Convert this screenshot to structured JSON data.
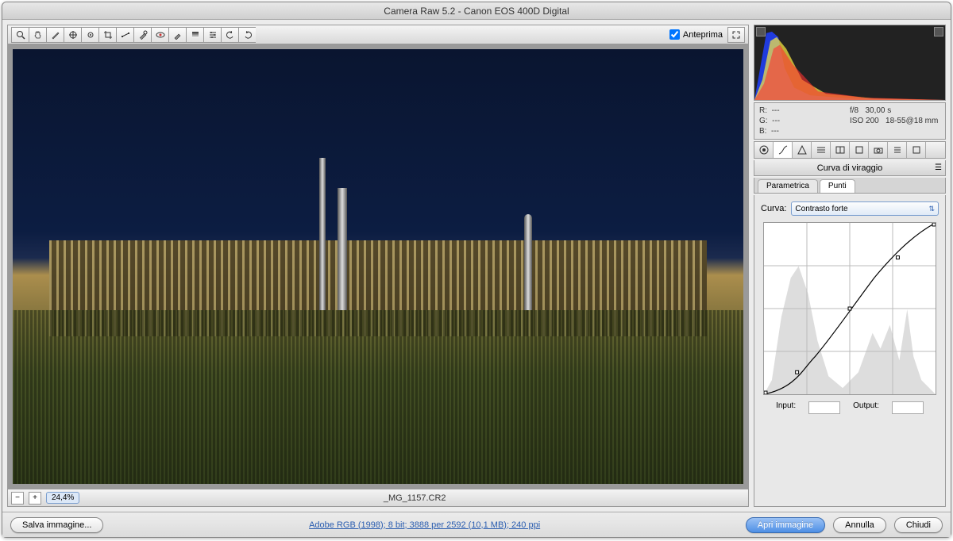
{
  "window_title": "Camera Raw 5.2  -  Canon EOS 400D Digital",
  "toolbar": {
    "preview_label": "Anteprima",
    "preview_checked": true
  },
  "zoom": {
    "minus": "−",
    "plus": "+",
    "value": "24,4%"
  },
  "filename": "_MG_1157.CR2",
  "info": {
    "r_label": "R:",
    "r_val": "---",
    "g_label": "G:",
    "g_val": "---",
    "b_label": "B:",
    "b_val": "---",
    "aperture": "f/8",
    "shutter": "30,00 s",
    "iso": "ISO 200",
    "lens": "18-55@18 mm"
  },
  "panel_title": "Curva di viraggio",
  "subtabs": {
    "parametrica": "Parametrica",
    "punti": "Punti"
  },
  "curve": {
    "label": "Curva:",
    "preset": "Contrasto forte",
    "input_label": "Input:",
    "output_label": "Output:",
    "input_val": "",
    "output_val": ""
  },
  "footer": {
    "save": "Salva immagine...",
    "link": "Adobe RGB (1998); 8 bit; 3888 per 2592 (10,1 MB); 240 ppi",
    "open": "Apri immagine",
    "cancel": "Annulla",
    "close": "Chiudi"
  }
}
